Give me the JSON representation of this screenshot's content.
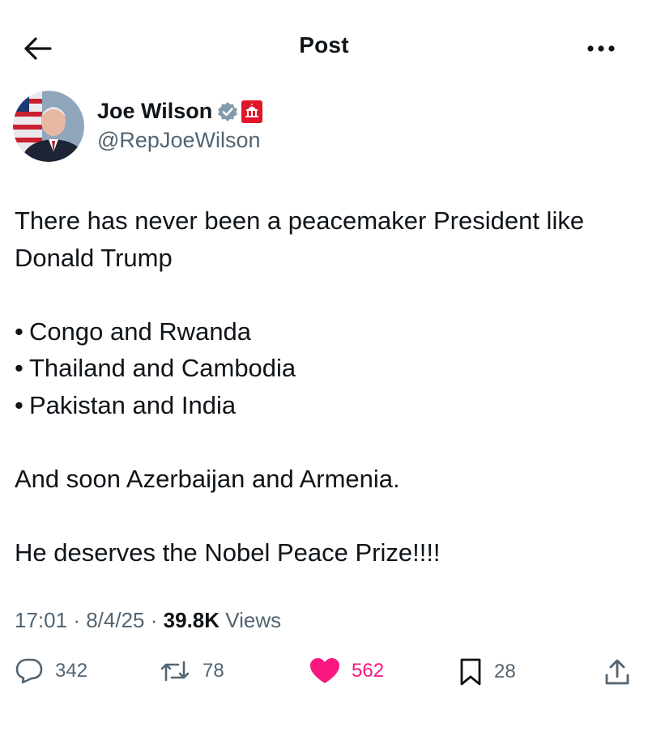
{
  "header": {
    "title": "Post",
    "back_icon": "arrow-left-icon",
    "more_icon": "more-horizontal-icon"
  },
  "author": {
    "display_name": "Joe Wilson",
    "handle": "@RepJoeWilson",
    "verified_icon": "verified-badge-icon",
    "affiliation_icon": "capitol-badge-icon"
  },
  "post": {
    "line1": "There has never been a peacemaker President like Donald Trump",
    "bullets": [
      "Congo and Rwanda",
      "Thailand and Cambodia",
      "Pakistan and India"
    ],
    "bullet_char": "•",
    "line2": "And soon Azerbaijan and Armenia.",
    "line3": "He deserves the Nobel Peace Prize!!!!"
  },
  "meta": {
    "time": "17:01",
    "separator": "·",
    "date": "8/4/25",
    "views_count": "39.8K",
    "views_label": "Views"
  },
  "actions": {
    "replies": "342",
    "reposts": "78",
    "likes": "562",
    "bookmarks": "28"
  },
  "colors": {
    "text": "#0f1419",
    "muted": "#536471",
    "like": "#f91880",
    "verified": "#829aab",
    "affiliation": "#e0162b"
  }
}
